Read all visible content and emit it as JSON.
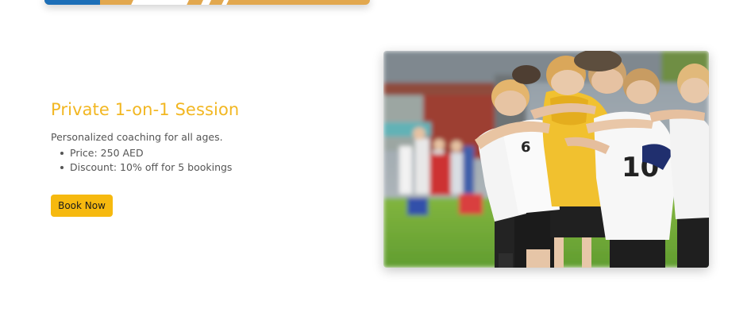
{
  "session": {
    "title": "Private 1-on-1 Session",
    "description": "Personalized coaching for all ages.",
    "details": [
      "Price: 250 AED",
      "Discount: 10% off for 5 bookings"
    ],
    "cta_label": "Book Now"
  },
  "photo": {
    "jersey_number": "10"
  },
  "colors": {
    "accent": "#f2b722",
    "button": "#f6b90f",
    "text": "#555555",
    "strip_orange": "#e2a84f",
    "strip_blue": "#1d6fb8"
  }
}
